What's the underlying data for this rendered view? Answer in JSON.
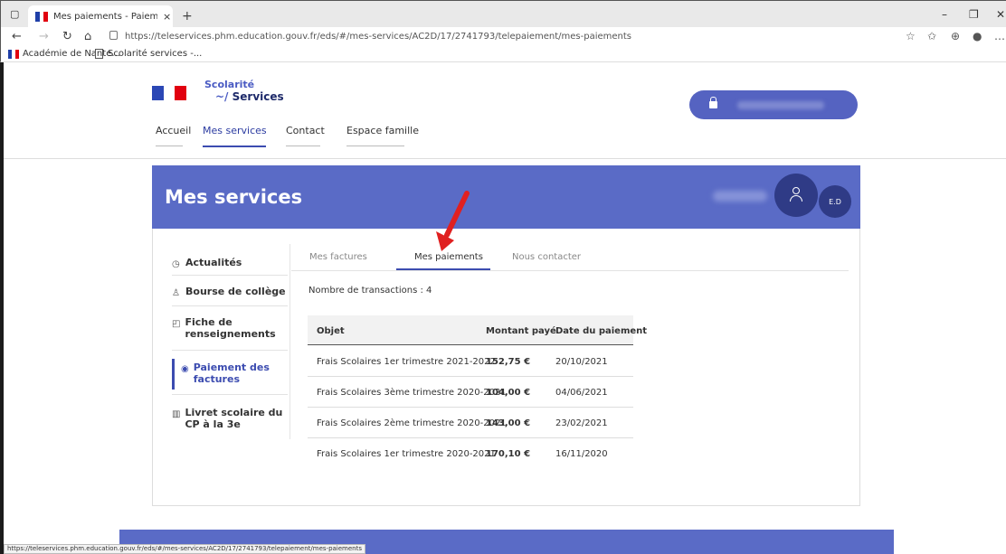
{
  "browser": {
    "tab_title": "Mes paiements - Paiement des fac",
    "tab_close": "×",
    "new_tab": "+",
    "url": "https://teleservices.phm.education.gouv.fr/eds/#/mes-services/AC2D/17/2741793/telepaiement/mes-paiements",
    "bookmarks": [
      "Académie de Nante...",
      "Scolarité services -..."
    ],
    "status_url": "https://teleservices.phm.education.gouv.fr/eds/#/mes-services/AC2D/17/2741793/telepaiement/mes-paiements"
  },
  "site": {
    "logo_line1": "Scolarité",
    "logo_line2": "Services",
    "nav": [
      "Accueil",
      "Mes services",
      "Contact",
      "Espace famille"
    ],
    "page_title": "Mes services",
    "user_initials": "E.D"
  },
  "sidemenu": {
    "items": [
      {
        "label": "Actualités",
        "icon": "clock-icon"
      },
      {
        "label": "Bourse de collège",
        "icon": "graduation-icon"
      },
      {
        "label": "Fiche de renseignements",
        "icon": "form-icon"
      },
      {
        "label": "Paiement des factures",
        "icon": "payment-icon"
      },
      {
        "label": "Livret scolaire du CP à la 3e",
        "icon": "book-icon"
      }
    ]
  },
  "tabs": [
    "Mes factures",
    "Mes paiements",
    "Nous contacter"
  ],
  "payments": {
    "count_label": "Nombre de transactions : 4",
    "headers": [
      "Objet",
      "Montant payé",
      "Date du paiement"
    ],
    "rows": [
      {
        "objet": "Frais Scolaires 1er trimestre 2021-2022",
        "montant": "152,75 €",
        "date": "20/10/2021"
      },
      {
        "objet": "Frais Scolaires 3ème trimestre 2020-2021",
        "montant": "104,00 €",
        "date": "04/06/2021"
      },
      {
        "objet": "Frais Scolaires 2ème trimestre 2020-2021",
        "montant": "143,00 €",
        "date": "23/02/2021"
      },
      {
        "objet": "Frais Scolaires 1er trimestre 2020-2021",
        "montant": "170,10 €",
        "date": "16/11/2020"
      }
    ]
  },
  "colors": {
    "primary": "#5a6bc6",
    "dark": "#2f3b86",
    "accent": "#3c4cb0",
    "arrow": "#e02020"
  }
}
